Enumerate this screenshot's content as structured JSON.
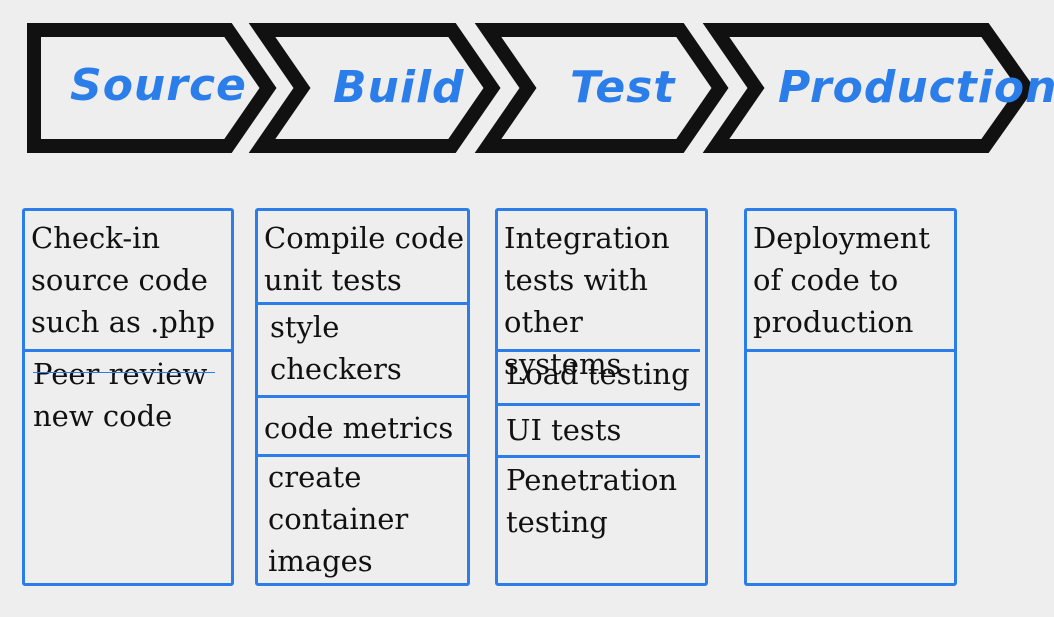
{
  "stages": [
    {
      "label": "Source"
    },
    {
      "label": "Build"
    },
    {
      "label": "Test"
    },
    {
      "label": "Production"
    }
  ],
  "columns": [
    {
      "stage": "Source",
      "cells": [
        {
          "text": "Check-in\nsource code\nsuch as .php"
        },
        {
          "text": "Peer review\nnew code"
        }
      ]
    },
    {
      "stage": "Build",
      "cells": [
        {
          "text": "Compile code\nunit tests"
        },
        {
          "text": "style\ncheckers"
        },
        {
          "text": "code metrics"
        },
        {
          "text": "create\ncontainer\nimages"
        }
      ]
    },
    {
      "stage": "Test",
      "cells": [
        {
          "text": "Integration\ntests with\nother systems"
        },
        {
          "text": "Load testing"
        },
        {
          "text": "UI tests"
        },
        {
          "text": "Penetration\ntesting"
        }
      ]
    },
    {
      "stage": "Production",
      "cells": [
        {
          "text": "Deployment\nof code to\nproduction"
        }
      ]
    }
  ],
  "colors": {
    "accent": "#2b7de9",
    "arrow_stroke": "#111111",
    "background": "#eeeeee"
  }
}
